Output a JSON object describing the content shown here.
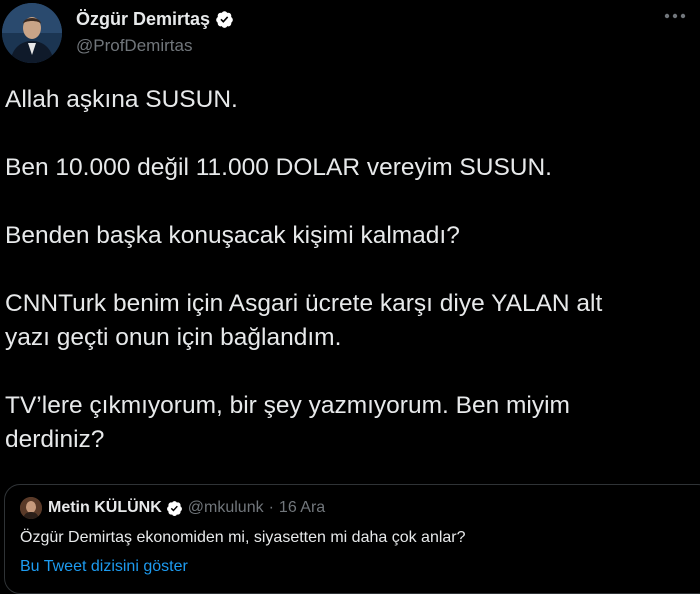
{
  "author": {
    "name": "Özgür Demirtaş",
    "handle": "@ProfDemirtas",
    "verified": true
  },
  "tweet": {
    "lines": [
      "Allah aşkına SUSUN.",
      "Ben 10.000 değil 11.000 DOLAR vereyim SUSUN.",
      "Benden başka konuşacak kişimi kalmadı?",
      "CNNTurk benim için Asgari ücrete karşı diye YALAN alt",
      "yazı geçti onun için bağlandım.",
      "TV’lere çıkmıyorum, bir şey yazmıyorum. Ben miyim",
      "derdiniz?"
    ]
  },
  "quote": {
    "name": "Metin KÜLÜNK",
    "handle": "@mkulunk",
    "separator": "·",
    "date": "16 Ara",
    "text": "Özgür Demirtaş ekonomiden mi, siyasetten mi daha çok anlar?",
    "thread_link": "Bu Tweet dizisini göster"
  },
  "colors": {
    "background": "#000000",
    "text_primary": "#e7e9ea",
    "text_secondary": "#71767b",
    "link": "#1d9bf0",
    "verified_badge": "#ffffff",
    "border": "#2f3336"
  },
  "icons": {
    "verified": "verified-badge-icon",
    "more": "more-options-icon"
  }
}
